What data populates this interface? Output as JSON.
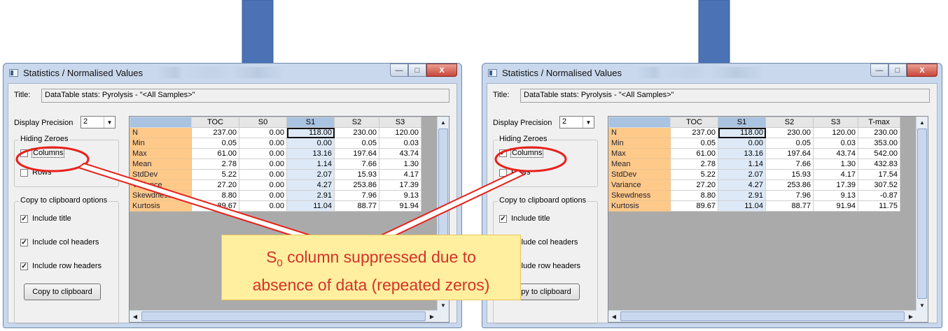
{
  "windows": {
    "left": {
      "window_title": "Statistics / Normalised Values",
      "title_label": "Title:",
      "title_value": "DataTable stats: Pyrolysis - \"<All Samples>\"",
      "precision_label": "Display Precision",
      "precision_value": "2",
      "hiding_zeroes": {
        "label": "Hiding Zeroes",
        "columns_label": "Columns",
        "columns_checked": false,
        "rows_label": "Rows",
        "rows_checked": false
      },
      "clipboard": {
        "label": "Copy to clipboard options",
        "include_title": "Include title",
        "include_col_headers": "Include col headers",
        "include_row_headers": "Include row headers"
      },
      "copy_button": "Copy to clipboard",
      "columns": [
        "TOC",
        "S0",
        "S1",
        "S2",
        "S3"
      ],
      "highlight_column": "S1",
      "rows": [
        {
          "label": "N",
          "values": [
            "237.00",
            "0.00",
            "118.00",
            "230.00",
            "120.00"
          ]
        },
        {
          "label": "Min",
          "values": [
            "0.05",
            "0.00",
            "0.00",
            "0.05",
            "0.03"
          ]
        },
        {
          "label": "Max",
          "values": [
            "61.00",
            "0.00",
            "13.16",
            "197.64",
            "43.74"
          ]
        },
        {
          "label": "Mean",
          "values": [
            "2.78",
            "0.00",
            "1.14",
            "7.66",
            "1.30"
          ]
        },
        {
          "label": "StdDev",
          "values": [
            "5.22",
            "0.00",
            "2.07",
            "15.93",
            "4.17"
          ]
        },
        {
          "label": "Variance",
          "values": [
            "27.20",
            "0.00",
            "4.27",
            "253.86",
            "17.39"
          ]
        },
        {
          "label": "Skewdness",
          "values": [
            "8.80",
            "0.00",
            "2.91",
            "7.96",
            "9.13"
          ]
        },
        {
          "label": "Kurtosis",
          "values": [
            "89.67",
            "0.00",
            "11.04",
            "88.77",
            "91.94"
          ]
        }
      ]
    },
    "right": {
      "window_title": "Statistics / Normalised Values",
      "title_label": "Title:",
      "title_value": "DataTable stats: Pyrolysis - \"<All Samples>\"",
      "precision_label": "Display Precision",
      "precision_value": "2",
      "hiding_zeroes": {
        "label": "Hiding Zeroes",
        "columns_label": "Columns",
        "columns_checked": true,
        "rows_label": "Rows",
        "rows_checked": false
      },
      "clipboard": {
        "label": "Copy to clipboard options",
        "include_title": "Include title",
        "include_col_headers": "Include col headers",
        "include_row_headers": "Include row headers"
      },
      "copy_button": "Copy to clipboard",
      "columns": [
        "TOC",
        "S1",
        "S2",
        "S3",
        "T-max"
      ],
      "highlight_column": "S1",
      "rows": [
        {
          "label": "N",
          "values": [
            "237.00",
            "118.00",
            "230.00",
            "120.00",
            "230.00"
          ]
        },
        {
          "label": "Min",
          "values": [
            "0.05",
            "0.00",
            "0.05",
            "0.03",
            "353.00"
          ]
        },
        {
          "label": "Max",
          "values": [
            "61.00",
            "13.16",
            "197.64",
            "43.74",
            "542.00"
          ]
        },
        {
          "label": "Mean",
          "values": [
            "2.78",
            "1.14",
            "7.66",
            "1.30",
            "432.83"
          ]
        },
        {
          "label": "StdDev",
          "values": [
            "5.22",
            "2.07",
            "15.93",
            "4.17",
            "17.54"
          ]
        },
        {
          "label": "Variance",
          "values": [
            "27.20",
            "4.27",
            "253.86",
            "17.39",
            "307.52"
          ]
        },
        {
          "label": "Skewdness",
          "values": [
            "8.80",
            "2.91",
            "7.96",
            "9.13",
            "-0.87"
          ]
        },
        {
          "label": "Kurtosis",
          "values": [
            "89.67",
            "11.04",
            "88.77",
            "91.94",
            "11.75"
          ]
        }
      ]
    }
  },
  "callout": {
    "line1_prefix": "S",
    "line1_sub": "0",
    "line1_suffix": " column suppressed  due to",
    "line2": "absence of data (repeated zeros)"
  },
  "colors": {
    "arrow": "#4a72b5",
    "annotation": "#e8211b",
    "callout_bg": "#ffef9f",
    "callout_text": "#d4322a"
  }
}
